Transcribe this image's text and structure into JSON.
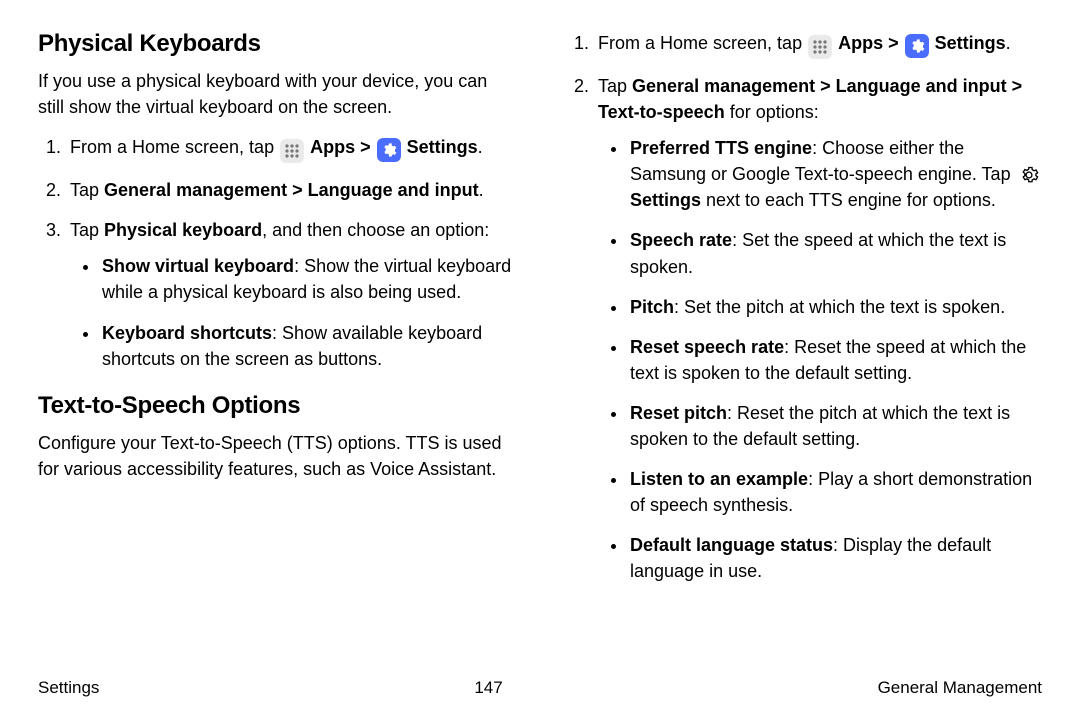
{
  "chev": ">",
  "left": {
    "h1": "Physical Keyboards",
    "p1": "If you use a physical keyboard with your device, you can still show the virtual keyboard on the screen.",
    "li1_pre": "From a Home screen, tap ",
    "li1_apps": "Apps",
    "li1_settings": "Settings",
    "li1_post": ".",
    "li2_pre": "Tap ",
    "li2_bold": "General management > Language and input",
    "li2_post": ".",
    "li3_pre": "Tap ",
    "li3_bold": "Physical keyboard",
    "li3_post": ", and then choose an option:",
    "li3a_b": "Show virtual keyboard",
    "li3a_t": ": Show the virtual keyboard while a physical keyboard is also being used.",
    "li3b_b": "Keyboard shortcuts",
    "li3b_t": ": Show available keyboard shortcuts on the screen as buttons.",
    "h2": "Text-to-Speech Options",
    "p2": "Configure your Text-to-Speech (TTS) options. TTS is used for various accessibility features, such as Voice Assistant."
  },
  "right": {
    "li1_pre": "From a Home screen, tap ",
    "li1_apps": "Apps",
    "li1_settings": "Settings",
    "li1_post": ".",
    "li2_pre": "Tap ",
    "li2_bold": "General management > Language and input > Text-to-speech",
    "li2_post": " for options:",
    "b_pref_b": "Preferred TTS engine",
    "b_pref_t1": ": Choose either the Samsung or Google Text-to-speech engine. Tap ",
    "b_pref_set": "Settings",
    "b_pref_t2": " next to each TTS engine for options.",
    "b_rate_b": "Speech rate",
    "b_rate_t": ": Set the speed at which the text is spoken.",
    "b_pitch_b": "Pitch",
    "b_pitch_t": ": Set the pitch at which the text is spoken.",
    "b_rrate_b": "Reset speech rate",
    "b_rrate_t": ": Reset the speed at which the text is spoken to the default setting.",
    "b_rpitch_b": "Reset pitch",
    "b_rpitch_t": ": Reset the pitch at which the text is spoken to the default setting.",
    "b_listen_b": "Listen to an example",
    "b_listen_t": ": Play a short demonstration of speech synthesis.",
    "b_lang_b": "Default language status",
    "b_lang_t": ": Display the default language in use."
  },
  "footer": {
    "left": "Settings",
    "center": "147",
    "right": "General Management"
  }
}
